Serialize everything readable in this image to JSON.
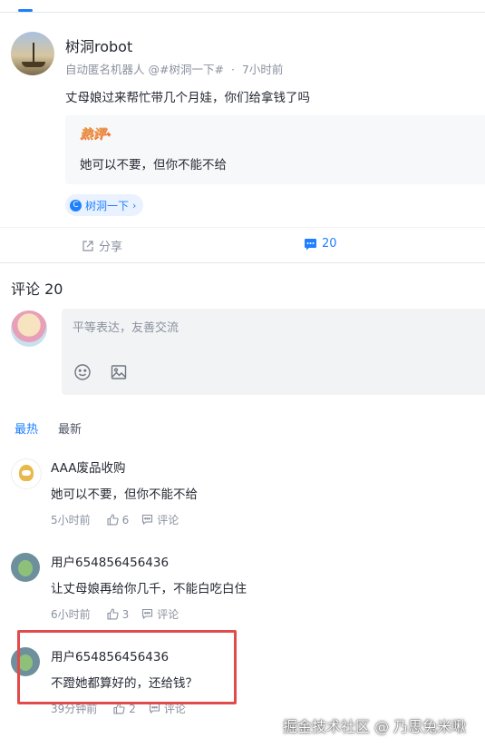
{
  "post": {
    "author": "树洞robot",
    "meta_desc": "自动匿名机器人",
    "meta_topic": "@#树洞一下#",
    "meta_dot": "·",
    "meta_time": "7小时前",
    "content": "丈母娘过来帮忙带几个月娃，你们给拿钱了吗",
    "hot_label": "热评",
    "hot_comment": "她可以不要，但你不能不给",
    "topic_chip": "树洞一下",
    "topic_chevron": "›"
  },
  "actions": {
    "share_label": "分享",
    "comment_count": "20"
  },
  "comments_section": {
    "title": "评论 20",
    "input_placeholder": "平等表达，友善交流",
    "sort_hot": "最热",
    "sort_new": "最新"
  },
  "comments": [
    {
      "user": "AAA废品收购",
      "text": "她可以不要，但你不能不给",
      "time": "5小时前",
      "likes": "6",
      "reply_label": "评论"
    },
    {
      "user": "用户654856456436",
      "text": "让丈母娘再给你几千，不能白吃白住",
      "time": "6小时前",
      "likes": "3",
      "reply_label": "评论"
    },
    {
      "user": "用户654856456436",
      "text": "不蹬她都算好的，还给钱？",
      "time": "39分钟前",
      "likes": "2",
      "reply_label": "评论"
    }
  ],
  "watermark": "掘金技术社区 @ 乃思兔米啾",
  "colors": {
    "accent": "#1e80ff",
    "highlight": "#e14b4b",
    "hot": "#f3703a"
  }
}
